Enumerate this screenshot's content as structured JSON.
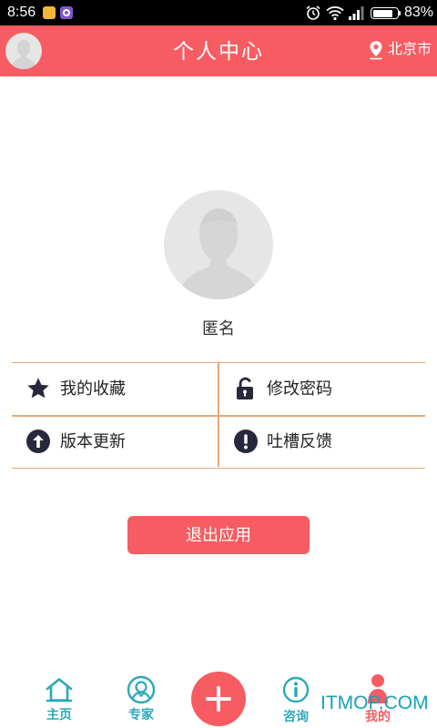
{
  "status_bar": {
    "time": "8:56",
    "battery": "83%",
    "battery_level": 0.83,
    "icons": [
      "app-notification-icon",
      "app-notification-icon",
      "alarm-icon",
      "wifi-icon",
      "signal-icon",
      "battery-icon"
    ]
  },
  "header": {
    "title": "个人中心",
    "location": "北京市",
    "location_icon": "location-pin-icon",
    "avatar_icon": "avatar-placeholder"
  },
  "profile": {
    "name": "匿名",
    "avatar_icon": "avatar-placeholder"
  },
  "menu": [
    {
      "label": "我的收藏",
      "icon": "star-icon"
    },
    {
      "label": "修改密码",
      "icon": "unlock-icon"
    },
    {
      "label": "版本更新",
      "icon": "arrow-up-circle-icon"
    },
    {
      "label": "吐槽反馈",
      "icon": "exclamation-circle-icon"
    }
  ],
  "logout_label": "退出应用",
  "bottom_nav": {
    "items": [
      {
        "label": "主页",
        "icon": "home-icon"
      },
      {
        "label": "专家",
        "icon": "expert-icon"
      },
      {
        "label": "咨询",
        "icon": "info-icon"
      },
      {
        "label": "我的",
        "icon": "user-icon",
        "active": true
      }
    ],
    "center_icon": "plus-icon"
  },
  "watermark": "ITMOP.COM",
  "colors": {
    "accent": "#f75c62",
    "teal": "#2ba9b9",
    "grid_line": "#e6a874",
    "icon_dark": "#26283c"
  }
}
